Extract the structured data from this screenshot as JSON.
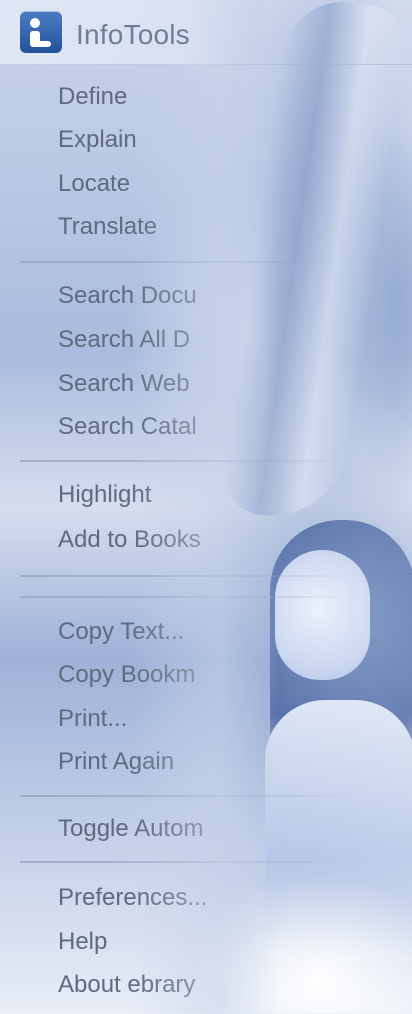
{
  "menu": {
    "title": "InfoTools",
    "items": [
      {
        "label": "Define"
      },
      {
        "label": "Explain"
      },
      {
        "label": "Locate"
      },
      {
        "label": "Translate"
      },
      {
        "label": "Search Docu"
      },
      {
        "label": "Search All D"
      },
      {
        "label": "Search Web"
      },
      {
        "label": "Search Catal"
      },
      {
        "label": "Highlight"
      },
      {
        "label": "Add to Books"
      },
      {
        "label": "Copy Text..."
      },
      {
        "label": "Copy Bookm"
      },
      {
        "label": "Print..."
      },
      {
        "label": "Print Again"
      },
      {
        "label": "Toggle Autom"
      },
      {
        "label": "Preferences..."
      },
      {
        "label": "Help"
      },
      {
        "label": "About ebrary"
      }
    ]
  },
  "icons": {
    "app": "infotools-app-icon"
  },
  "colors": {
    "menu_text": "#5d6a80",
    "icon_blue": "#24539b"
  }
}
